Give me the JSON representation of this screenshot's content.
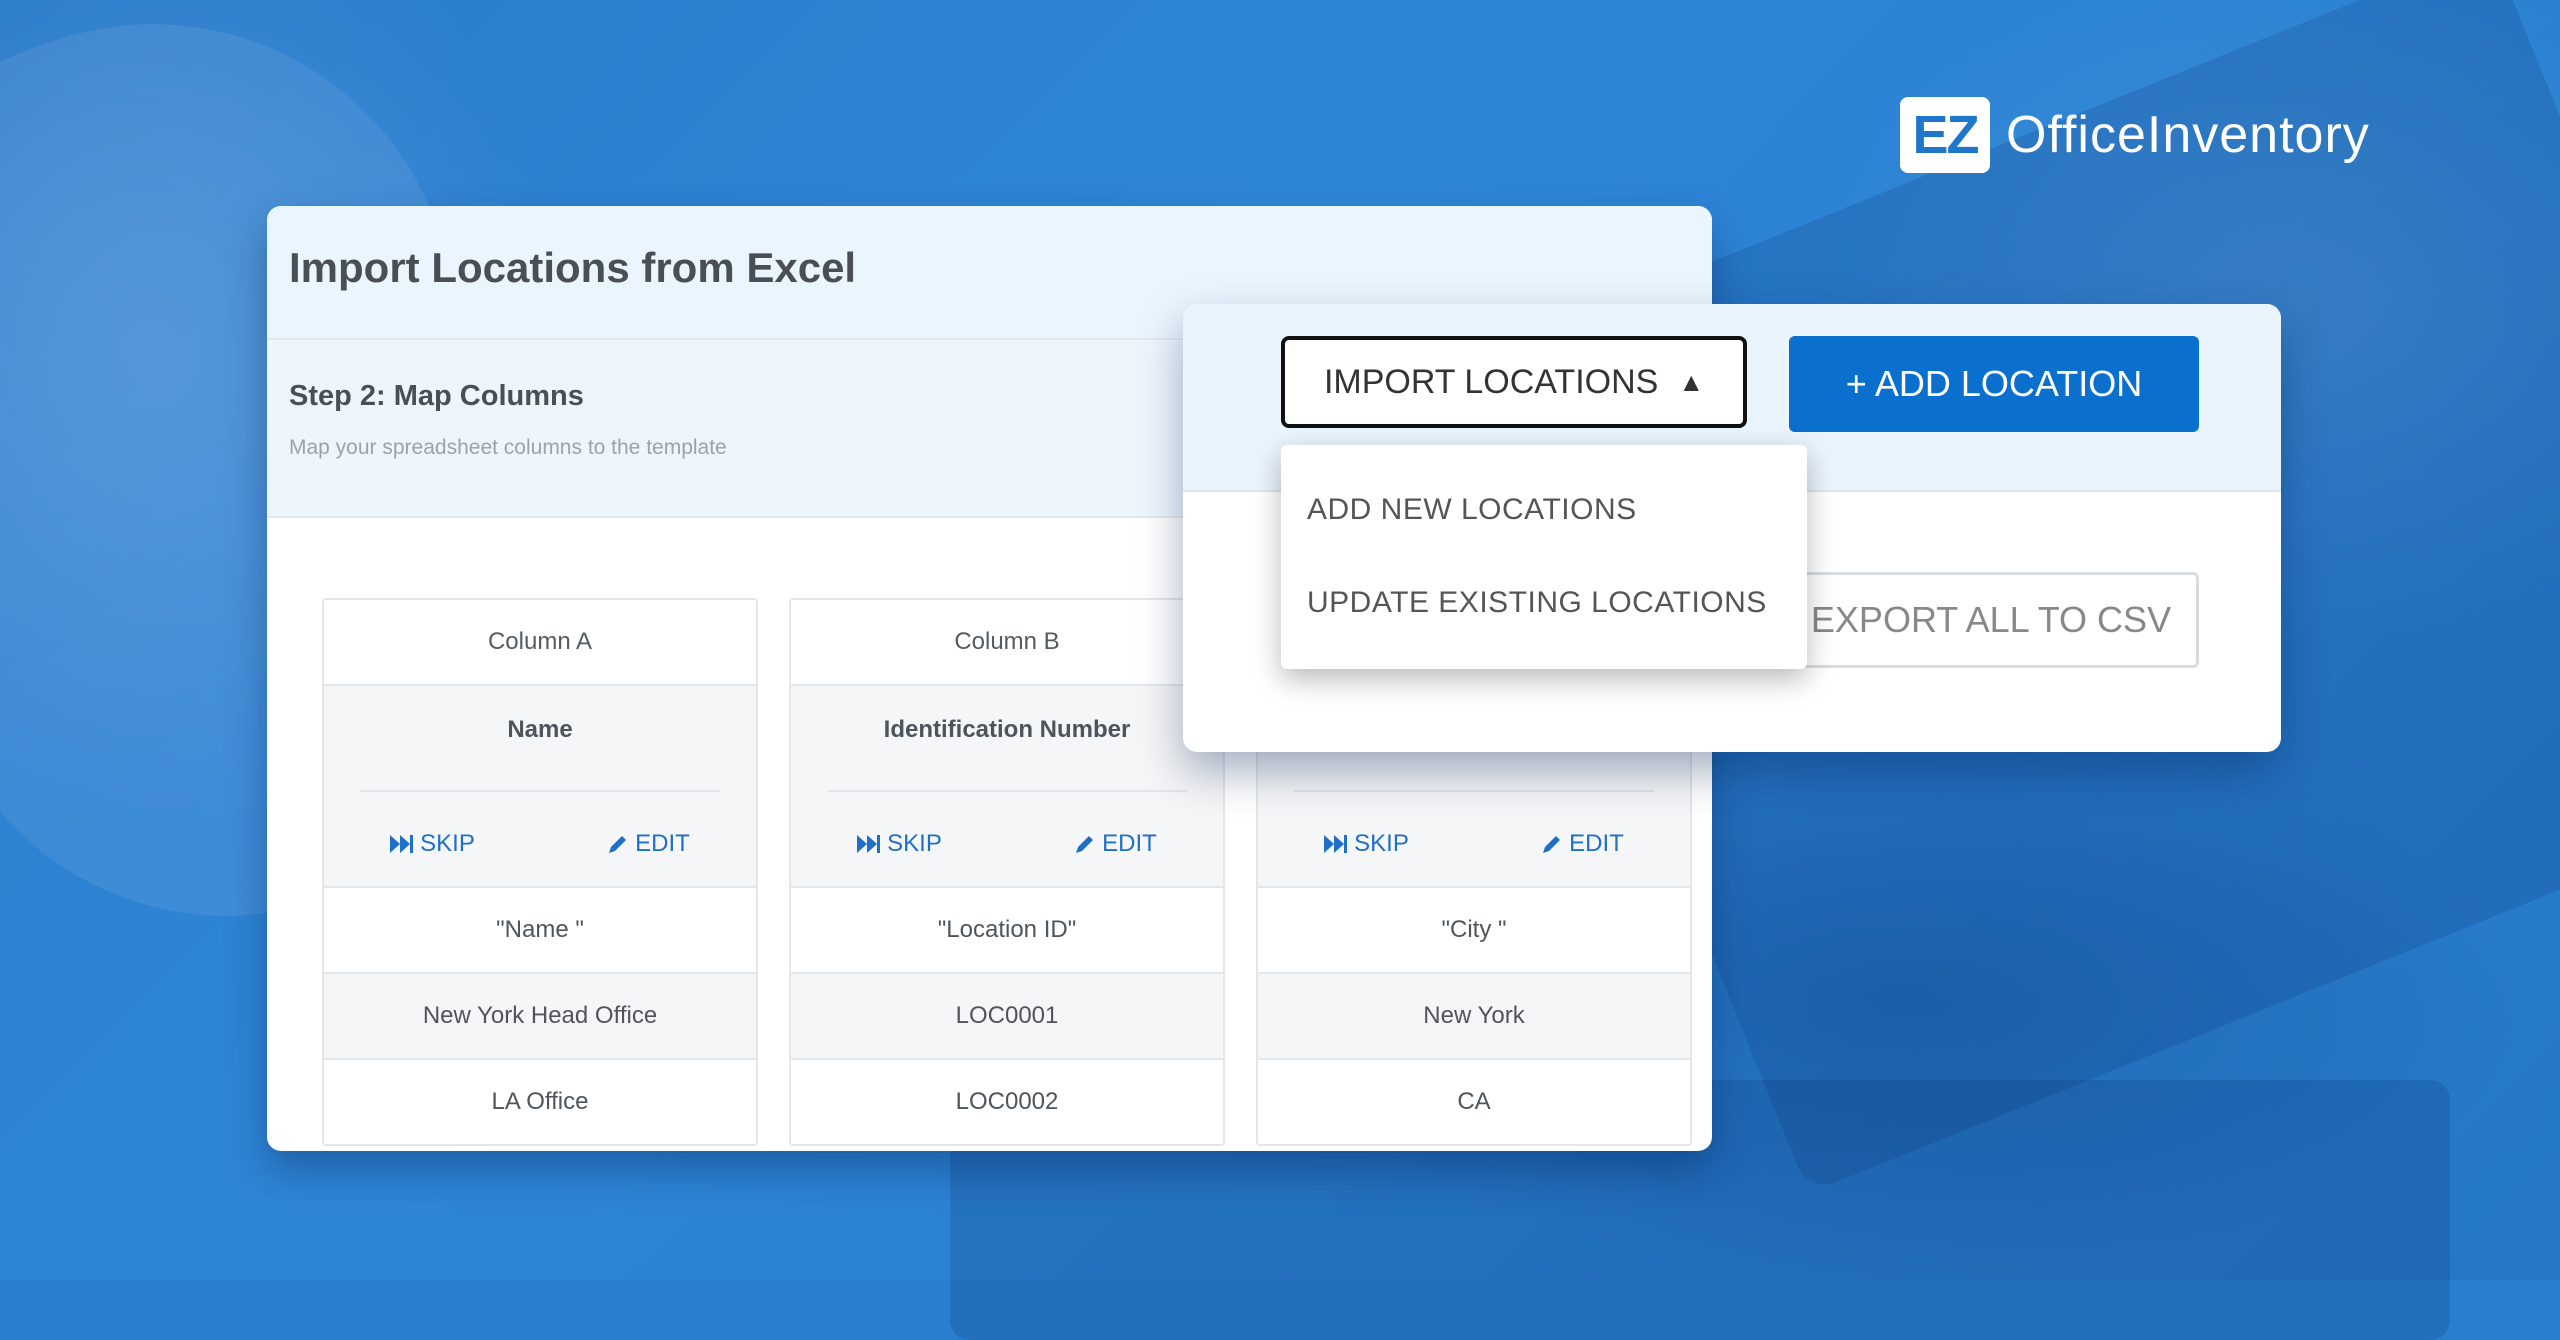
{
  "brand": {
    "logo_mark": "EZ",
    "logo_text": "OfficeInventory"
  },
  "panel": {
    "title": "Import Locations from Excel",
    "step_title": "Step 2: Map Columns",
    "step_subtitle": "Map your spreadsheet columns to the template"
  },
  "columns": [
    {
      "header": "Column A",
      "field": "Name",
      "skip": "SKIP",
      "edit": "EDIT",
      "rows": [
        "\"Name \"",
        "New York Head Office",
        "LA Office"
      ]
    },
    {
      "header": "Column B",
      "field": "Identification Number",
      "skip": "SKIP",
      "edit": "EDIT",
      "rows": [
        "\"Location ID\"",
        "LOC0001",
        "LOC0002"
      ]
    },
    {
      "header": "",
      "field": "",
      "skip": "SKIP",
      "edit": "EDIT",
      "rows": [
        "\"City \"",
        "New York",
        "CA"
      ]
    }
  ],
  "toolbar": {
    "import_label": "IMPORT LOCATIONS",
    "add_label": "+ ADD LOCATION",
    "export_label": "EXPORT ALL TO CSV"
  },
  "dropdown": {
    "items": [
      "ADD NEW LOCATIONS",
      "UPDATE EXISTING LOCATIONS"
    ]
  },
  "colors": {
    "accent": "#0b6fce",
    "link": "#1f6fc7"
  }
}
